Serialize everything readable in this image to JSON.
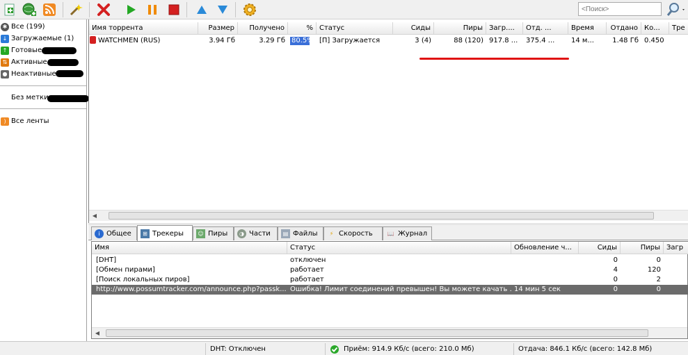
{
  "toolbar": {
    "buttons": [
      "add-torrent-icon",
      "add-url-icon",
      "rss-icon",
      "create-torrent-icon",
      "remove-icon",
      "start-icon",
      "pause-icon",
      "stop-icon",
      "move-up-icon",
      "move-down-icon",
      "settings-icon"
    ],
    "search_placeholder": "<Поиск>"
  },
  "sidebar": {
    "all": "Все (199)",
    "downloading": "Загружаемые (1)",
    "completed": "Готовые",
    "active": "Активные",
    "inactive": "Неактивные",
    "no_label": "Без метки",
    "all_feeds": "Все ленты"
  },
  "torrent_list": {
    "columns": [
      "Имя торрента",
      "Размер",
      "Получено",
      "%",
      "Статус",
      "Сиды",
      "Пиры",
      "Загр....",
      "Отд. ...",
      "Время",
      "Отдано",
      "Ко...",
      "Тре"
    ],
    "rows": [
      {
        "name": "WATCHMEN (RUS)",
        "size": "3.94 Гб",
        "received": "3.29 Гб",
        "percent": "80.5%",
        "progress": 0.805,
        "status": "[П] Загружается",
        "seeds": "3 (4)",
        "peers": "88 (120)",
        "down": "917.8 ...",
        "up": "375.4 ...",
        "time": "14 м...",
        "uploaded": "1.48 Гб",
        "ratio": "0.450"
      }
    ]
  },
  "tabs": [
    "Общее",
    "Трекеры",
    "Пиры",
    "Части",
    "Файлы",
    "Скорость",
    "Журнал"
  ],
  "active_tab": "Трекеры",
  "trackers": {
    "columns": [
      "Имя",
      "Статус",
      "Обновление ч...",
      "Сиды",
      "Пиры",
      "Загр"
    ],
    "rows": [
      {
        "name": "[DHT]",
        "status": "отключен",
        "update": "",
        "seeds": "0",
        "peers": "0"
      },
      {
        "name": "[Обмен пирами]",
        "status": "работает",
        "update": "",
        "seeds": "4",
        "peers": "120"
      },
      {
        "name": "[Поиск локальных пиров]",
        "status": "работает",
        "update": "",
        "seeds": "0",
        "peers": "2"
      },
      {
        "name": "http://www.possumtracker.com/announce.php?passk...",
        "status": "Ошибка! Лимит соединений превышен! Вы можете качать ...",
        "update": "14 мин 5 сек",
        "seeds": "0",
        "peers": "0"
      }
    ]
  },
  "statusbar": {
    "dht": "DHT: Отключен",
    "download": "Приём: 914.9 Кб/с (всего: 210.0 Мб)",
    "upload": "Отдача: 846.1 Кб/с (всего: 142.8 Мб)"
  },
  "colors": {
    "progress": "#3a6fd8",
    "selected_row": "#6b6b6b",
    "annotation": "#e01010"
  }
}
